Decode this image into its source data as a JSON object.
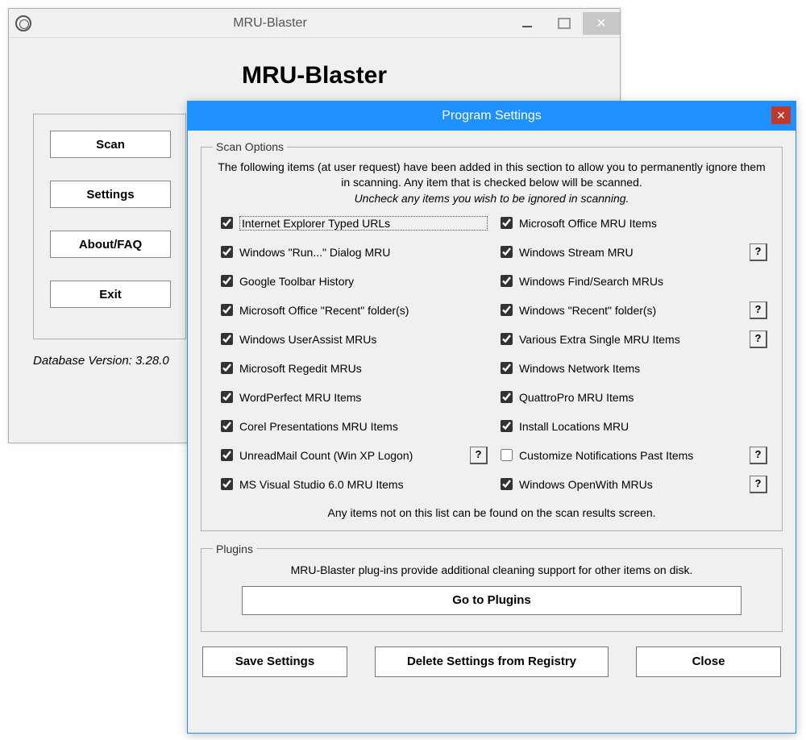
{
  "main": {
    "title": "MRU-Blaster",
    "heading": "MRU-Blaster",
    "buttons": {
      "scan": "Scan",
      "settings": "Settings",
      "about": "About/FAQ",
      "exit": "Exit"
    },
    "db_version": "Database Version: 3.28.0"
  },
  "dialog": {
    "title": "Program Settings",
    "scan_group_legend": "Scan Options",
    "scan_intro": "The following items (at user request) have been added in this section to allow you to permanently ignore them in scanning. Any item that is checked below will be scanned.",
    "scan_hint": "Uncheck any items you wish to be ignored in scanning.",
    "scan_footer": "Any items not on this list can be found on the scan results screen.",
    "options_left": [
      {
        "label": "Internet Explorer Typed URLs",
        "checked": true,
        "focused": true,
        "help": false
      },
      {
        "label": "Windows \"Run...\" Dialog MRU",
        "checked": true,
        "help": false
      },
      {
        "label": "Google Toolbar History",
        "checked": true,
        "help": false
      },
      {
        "label": "Microsoft Office \"Recent\" folder(s)",
        "checked": true,
        "help": false
      },
      {
        "label": "Windows UserAssist MRUs",
        "checked": true,
        "help": false
      },
      {
        "label": "Microsoft Regedit MRUs",
        "checked": true,
        "help": false
      },
      {
        "label": "WordPerfect MRU Items",
        "checked": true,
        "help": false
      },
      {
        "label": "Corel Presentations MRU Items",
        "checked": true,
        "help": false
      },
      {
        "label": "UnreadMail Count (Win XP Logon)",
        "checked": true,
        "help": true
      },
      {
        "label": "MS Visual Studio 6.0 MRU Items",
        "checked": true,
        "help": false
      }
    ],
    "options_right": [
      {
        "label": "Microsoft Office MRU Items",
        "checked": true,
        "help": false
      },
      {
        "label": "Windows Stream MRU",
        "checked": true,
        "help": true
      },
      {
        "label": "Windows Find/Search MRUs",
        "checked": true,
        "help": false
      },
      {
        "label": "Windows \"Recent\" folder(s)",
        "checked": true,
        "help": true
      },
      {
        "label": "Various Extra Single MRU Items",
        "checked": true,
        "help": true
      },
      {
        "label": "Windows Network Items",
        "checked": true,
        "help": false
      },
      {
        "label": "QuattroPro MRU Items",
        "checked": true,
        "help": false
      },
      {
        "label": "Install Locations MRU",
        "checked": true,
        "help": false
      },
      {
        "label": "Customize Notifications Past Items",
        "checked": false,
        "help": true
      },
      {
        "label": "Windows OpenWith MRUs",
        "checked": true,
        "help": true
      }
    ],
    "plugins_legend": "Plugins",
    "plugins_text": "MRU-Blaster plug-ins provide additional cleaning support for other items on disk.",
    "plugins_button": "Go to Plugins",
    "buttons": {
      "save": "Save Settings",
      "delete": "Delete Settings from Registry",
      "close": "Close"
    },
    "help_symbol": "?"
  }
}
